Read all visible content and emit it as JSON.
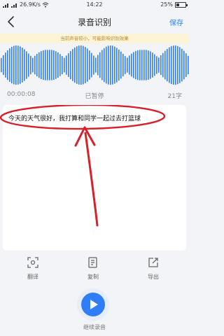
{
  "status_bar": {
    "network_speed": "26.9K/s",
    "time": "14:22",
    "battery": "25%",
    "battery_level": 0.25
  },
  "nav": {
    "title": "录音识别",
    "save_label": "保存"
  },
  "notice": "当前声音较小，可能影响识别效果",
  "playback": {
    "elapsed": "00:00:08",
    "state": "已暂停",
    "char_count": "21字"
  },
  "transcript": "今天的天气很好，我打算和同学一起过去打篮球",
  "actions": [
    {
      "label": "翻译",
      "icon": "translate-icon"
    },
    {
      "label": "复制",
      "icon": "copy-icon"
    },
    {
      "label": "导出",
      "icon": "export-icon"
    }
  ],
  "record": {
    "label": "继续录音",
    "icon": "play-icon"
  },
  "colors": {
    "accent": "#2f7ef7",
    "annotation": "#d8202a",
    "notice_bg": "#fdf4d6",
    "notice_text": "#b9862c"
  }
}
